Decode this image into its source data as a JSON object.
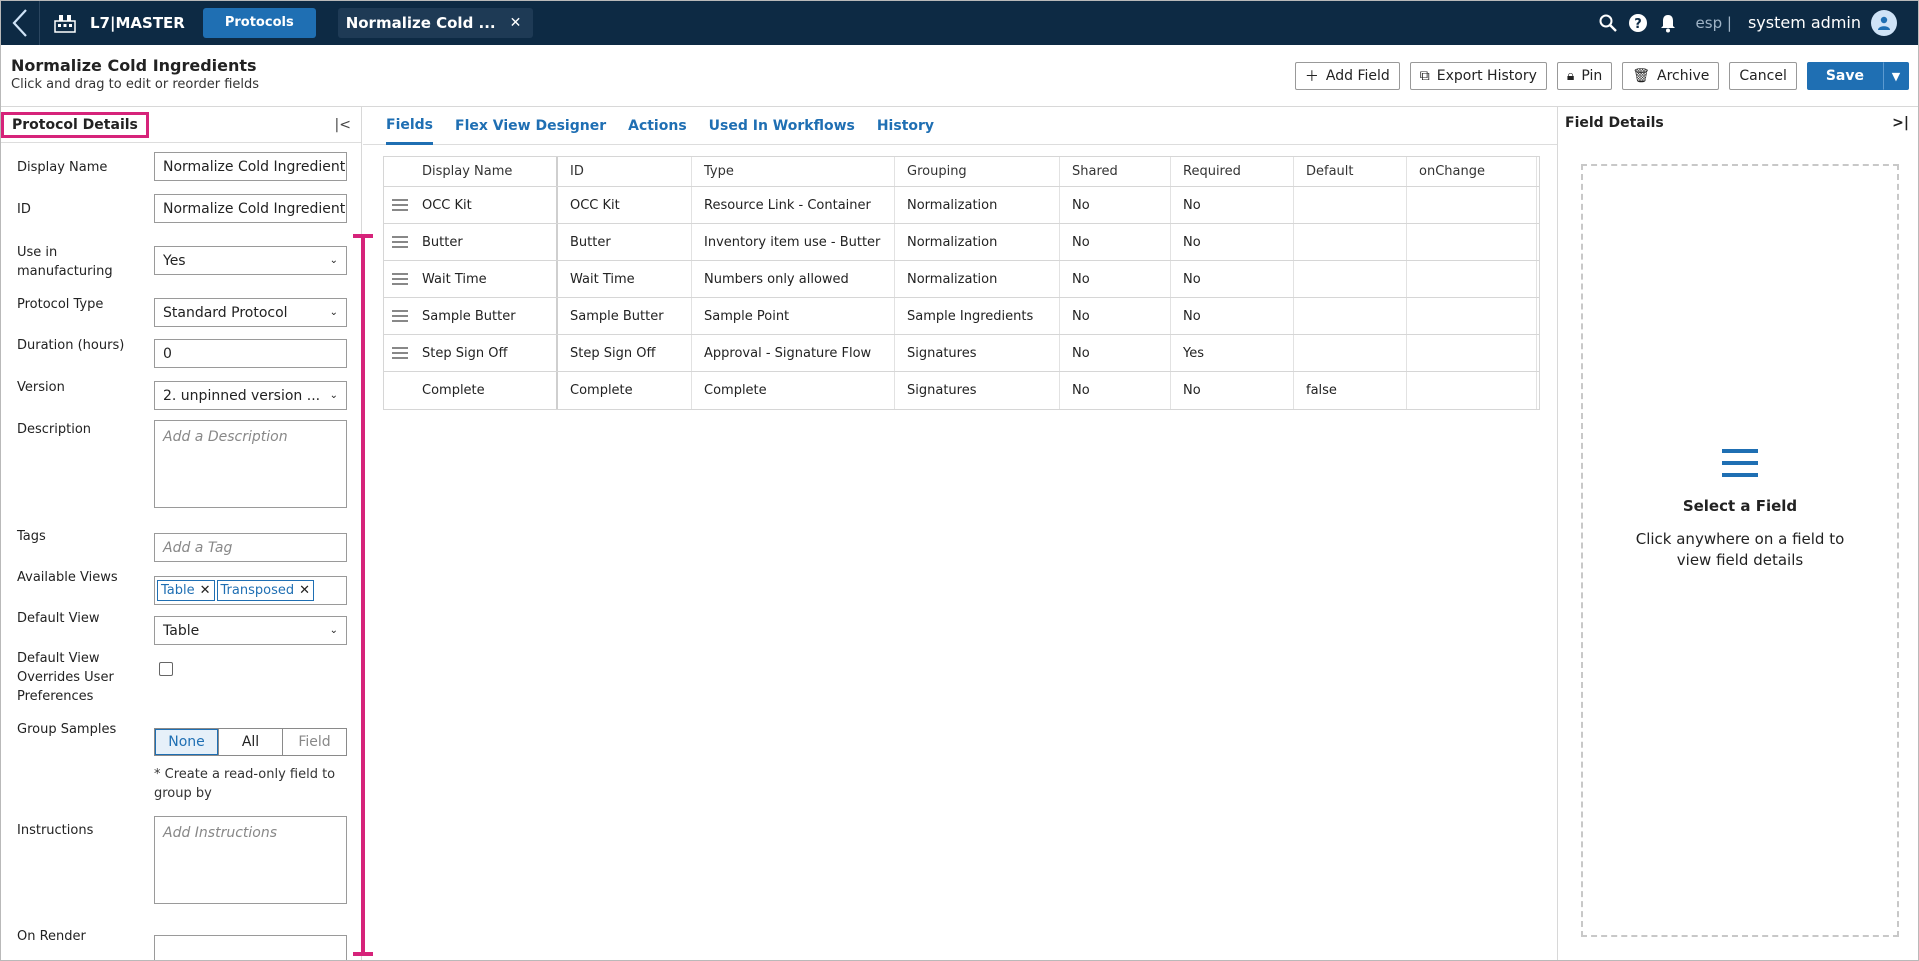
{
  "topbar": {
    "brand": "L7|MASTER",
    "nav_protocols": "Protocols",
    "open_tab": "Normalize Cold ...",
    "lang": "esp |",
    "user": "system admin"
  },
  "header": {
    "title": "Normalize Cold Ingredients",
    "subtitle": "Click and drag to edit or reorder fields",
    "add_field": "Add Field",
    "export_history": "Export History",
    "pin": "Pin",
    "archive": "Archive",
    "cancel": "Cancel",
    "save": "Save"
  },
  "left": {
    "title": "Protocol Details",
    "display_name_label": "Display Name",
    "display_name_value": "Normalize Cold Ingredient",
    "id_label": "ID",
    "id_value": "Normalize Cold Ingredient",
    "use_mfg_label": "Use in manufacturing",
    "use_mfg_value": "Yes",
    "protocol_type_label": "Protocol Type",
    "protocol_type_value": "Standard Protocol",
    "duration_label": "Duration (hours)",
    "duration_value": "0",
    "version_label": "Version",
    "version_value": "2. unpinned version ...",
    "description_label": "Description",
    "description_placeholder": "Add a Description",
    "tags_label": "Tags",
    "tags_placeholder": "Add a Tag",
    "views_label": "Available Views",
    "views": [
      "Table",
      "Transposed"
    ],
    "default_view_label": "Default View",
    "default_view_value": "Table",
    "override_label": "Default View Overrides User Preferences",
    "group_label": "Group Samples",
    "group_options": [
      "None",
      "All",
      "Field"
    ],
    "group_note": "* Create a read-only field to group by",
    "instructions_label": "Instructions",
    "instructions_placeholder": "Add Instructions",
    "onrender_label": "On Render"
  },
  "center": {
    "tabs": [
      "Fields",
      "Flex View Designer",
      "Actions",
      "Used In Workflows",
      "History"
    ],
    "columns": [
      "Display Name",
      "ID",
      "Type",
      "Grouping",
      "Shared",
      "Required",
      "Default",
      "onChange"
    ],
    "rows": [
      {
        "name": "OCC Kit",
        "id": "OCC Kit",
        "type": "Resource Link - Container",
        "grouping": "Normalization",
        "shared": "No",
        "required": "No",
        "default": ""
      },
      {
        "name": "Butter",
        "id": "Butter",
        "type": "Inventory item use - Butter",
        "grouping": "Normalization",
        "shared": "No",
        "required": "No",
        "default": ""
      },
      {
        "name": "Wait Time",
        "id": "Wait Time",
        "type": "Numbers only allowed",
        "grouping": "Normalization",
        "shared": "No",
        "required": "No",
        "default": ""
      },
      {
        "name": "Sample Butter",
        "id": "Sample Butter",
        "type": "Sample Point",
        "grouping": "Sample Ingredients",
        "shared": "No",
        "required": "No",
        "default": ""
      },
      {
        "name": "Step Sign Off",
        "id": "Step Sign Off",
        "type": "Approval - Signature Flow",
        "grouping": "Signatures",
        "shared": "No",
        "required": "Yes",
        "default": ""
      },
      {
        "name": "Complete",
        "id": "Complete",
        "type": "Complete",
        "grouping": "Signatures",
        "shared": "No",
        "required": "No",
        "default": "false"
      }
    ]
  },
  "right": {
    "title": "Field Details",
    "select_title": "Select a Field",
    "select_text": "Click anywhere on a field to view field details"
  },
  "colors": {
    "accent": "#1f6fb3",
    "topbar": "#0d2a44",
    "highlight": "#d6237a"
  }
}
